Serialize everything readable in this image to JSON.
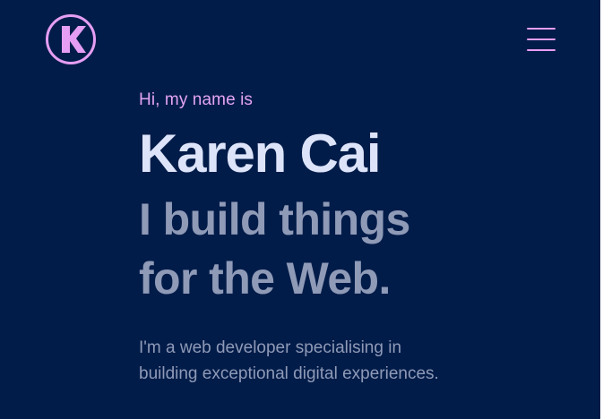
{
  "header": {
    "logo": {
      "icon": "k-circle-icon",
      "letter": "K",
      "color": "#e59ef3"
    },
    "menu": {
      "icon": "hamburger-menu-icon",
      "color": "#e59ef3"
    }
  },
  "hero": {
    "greeting": "Hi, my name is",
    "name": "Karen Cai",
    "tagline": "I build things for the Web.",
    "description": "I'm a web developer specialising in building exceptional digital experiences."
  },
  "colors": {
    "background": "#021c49",
    "accent": "#e59ef3",
    "heading": "#dde4fa",
    "muted": "#8f9ab7"
  }
}
